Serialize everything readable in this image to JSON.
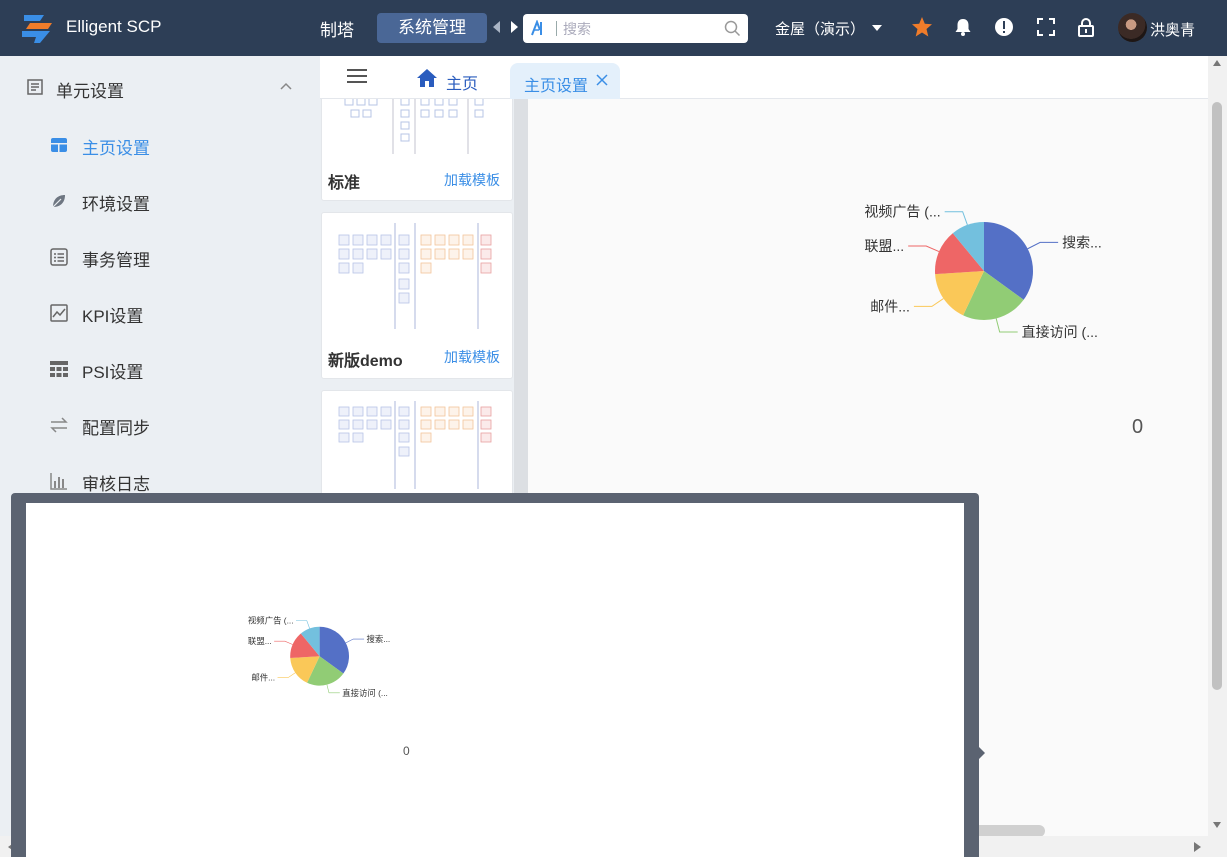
{
  "header": {
    "app_title": "Elligent SCP",
    "nav_prev_item": "制塔",
    "nav_active_item": "系统管理",
    "search_placeholder": "搜索",
    "org_selector": "金屋（演示）",
    "user_name": "洪奥青",
    "star_color": "#f07c2a"
  },
  "sidebar": {
    "group_label": "单元设置",
    "items": [
      {
        "label": "主页设置",
        "icon": "home-layout-icon",
        "active": true
      },
      {
        "label": "环境设置",
        "icon": "leaf-icon",
        "active": false
      },
      {
        "label": "事务管理",
        "icon": "list-icon",
        "active": false
      },
      {
        "label": "KPI设置",
        "icon": "trend-chart-icon",
        "active": false
      },
      {
        "label": "PSI设置",
        "icon": "grid-icon",
        "active": false
      },
      {
        "label": "配置同步",
        "icon": "sync-arrows-icon",
        "active": false
      },
      {
        "label": "审核日志",
        "icon": "bar-chart-icon",
        "active": false
      }
    ]
  },
  "tabs": {
    "home": "主页",
    "current": "主页设置"
  },
  "templates": [
    {
      "name": "标准",
      "load_label": "加载模板"
    },
    {
      "name": "新版demo",
      "load_label": "加载模板"
    }
  ],
  "preview": {
    "value": "0"
  },
  "popup": {
    "value": "0"
  },
  "chart_data": {
    "type": "pie",
    "categories": [
      "搜索...",
      "直接访问 (...",
      "邮件...",
      "联盟...",
      "视频广告 (..."
    ],
    "values": [
      35,
      22,
      17,
      15,
      11
    ],
    "colors": [
      "#5470c6",
      "#91cc75",
      "#fac858",
      "#ee6666",
      "#73c0de"
    ],
    "legend": false
  }
}
